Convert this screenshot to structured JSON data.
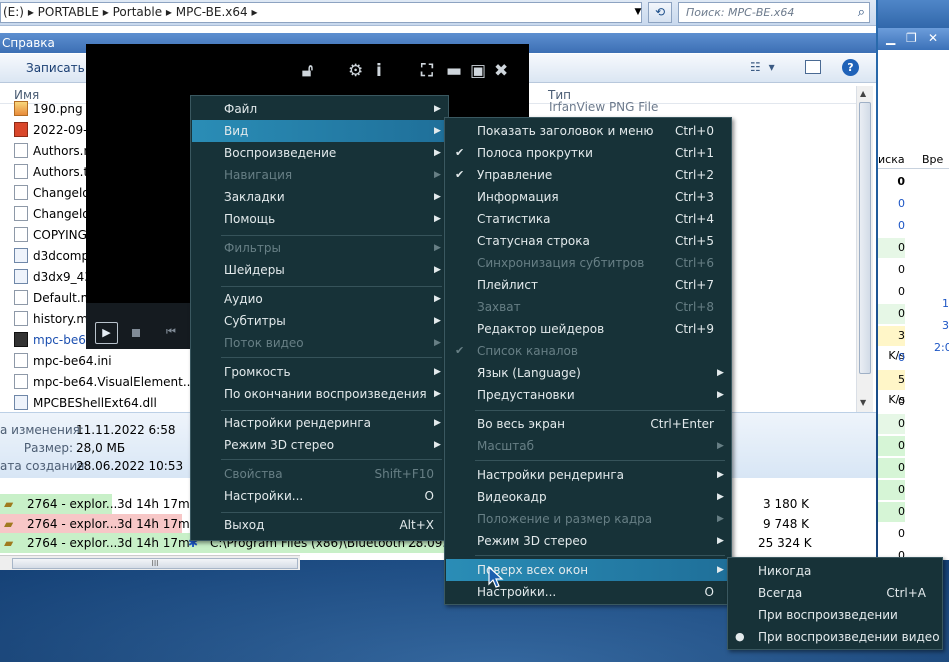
{
  "explorer": {
    "address_parts": [
      "(E:)",
      "PORTABLE",
      "Portable",
      "MPC-BE.x64"
    ],
    "search_placeholder": "Поиск: MPC-BE.x64",
    "menubar_label": "Справка",
    "toolbar_burn": "Записать н",
    "col_name": "Имя",
    "col_type": "Тип",
    "first_type": "IrfanView PNG File",
    "files": [
      {
        "name": "190.png",
        "icon": "image-icon"
      },
      {
        "name": "2022-09-1",
        "icon": "jpg-icon"
      },
      {
        "name": "Authors.n",
        "icon": "document-icon"
      },
      {
        "name": "Authors.tx",
        "icon": "document-icon"
      },
      {
        "name": "Changelo",
        "icon": "document-icon"
      },
      {
        "name": "Changelo",
        "icon": "document-icon"
      },
      {
        "name": "COPYING",
        "icon": "document-icon"
      },
      {
        "name": "d3dcomp",
        "icon": "dll-icon"
      },
      {
        "name": "d3dx9_43.",
        "icon": "dll-icon"
      },
      {
        "name": "Default.m",
        "icon": "document-icon"
      },
      {
        "name": "history.m",
        "icon": "document-icon"
      },
      {
        "name": "mpc-be64",
        "icon": "exe-icon"
      },
      {
        "name": "mpc-be64.ini",
        "icon": "document-icon"
      },
      {
        "name": "mpc-be64.VisualElement...",
        "icon": "document-icon"
      },
      {
        "name": "MPCBEShellExt64.dll",
        "icon": "dll-icon"
      }
    ],
    "details": [
      {
        "label": "а изменения:",
        "value": "11.11.2022 6:58"
      },
      {
        "label": "Размер:",
        "value": "28,0 МБ"
      },
      {
        "label": "ата создания:",
        "value": "28.06.2022 10:53"
      }
    ]
  },
  "processes": {
    "rows": [
      {
        "name": "2764 - explor...",
        "time": "3d 14h 17m",
        "path": "",
        "date": "",
        "mem": "3 180 K"
      },
      {
        "name": "2764 - explor...",
        "time": "3d 14h 17m",
        "path": "",
        "date": "",
        "mem": "9 748 K"
      },
      {
        "name": "2764 - explor...",
        "time": "3d 14h 17m",
        "path": "C:\\Program Files (x86)\\Bluetooth ...",
        "date": "28.09.2",
        "mem": "25 324 K"
      }
    ],
    "right_header": [
      "иска",
      "Вре"
    ],
    "right_values": [
      "0",
      "0",
      "0",
      "0",
      "0",
      "0",
      "0",
      "3 K/s",
      "0",
      "5 K/s",
      "0",
      "0",
      "0",
      "0",
      "0",
      "0",
      "0",
      "0",
      "0",
      "0"
    ],
    "right_extra": [
      "1",
      "3",
      "2:0"
    ],
    "hscroll_grip": "III"
  },
  "player": {
    "icons": [
      "unlock-icon",
      "gear-icon",
      "info-icon",
      "fullscreen-icon",
      "minimize-icon",
      "maximize-icon",
      "close-icon"
    ]
  },
  "menu_main": {
    "items": [
      {
        "label": "Файл",
        "sub": true
      },
      {
        "label": "Вид",
        "sub": true,
        "highlight": true
      },
      {
        "label": "Воспроизведение",
        "sub": true
      },
      {
        "label": "Навигация",
        "sub": true,
        "disabled": true
      },
      {
        "label": "Закладки",
        "sub": true
      },
      {
        "label": "Помощь",
        "sub": true
      },
      {
        "label": "Фильтры",
        "sub": true,
        "disabled": true
      },
      {
        "label": "Шейдеры",
        "sub": true
      },
      {
        "label": "Аудио",
        "sub": true
      },
      {
        "label": "Субтитры",
        "sub": true
      },
      {
        "label": "Поток видео",
        "sub": true,
        "disabled": true
      },
      {
        "label": "Громкость",
        "sub": true
      },
      {
        "label": "По окончании воспроизведения",
        "sub": true
      },
      {
        "label": "Настройки рендеринга",
        "sub": true
      },
      {
        "label": "Режим 3D стерео",
        "sub": true
      },
      {
        "label": "Свойства",
        "shortcut": "Shift+F10",
        "disabled": true
      },
      {
        "label": "Настройки...",
        "shortcut": "O"
      },
      {
        "label": "Выход",
        "shortcut": "Alt+X"
      }
    ]
  },
  "menu_view": {
    "items": [
      {
        "label": "Показать заголовок и меню",
        "shortcut": "Ctrl+0"
      },
      {
        "label": "Полоса прокрутки",
        "shortcut": "Ctrl+1",
        "checked": true
      },
      {
        "label": "Управление",
        "shortcut": "Ctrl+2",
        "checked": true
      },
      {
        "label": "Информация",
        "shortcut": "Ctrl+3"
      },
      {
        "label": "Статистика",
        "shortcut": "Ctrl+4"
      },
      {
        "label": "Статусная строка",
        "shortcut": "Ctrl+5"
      },
      {
        "label": "Синхронизация субтитров",
        "shortcut": "Ctrl+6",
        "disabled": true
      },
      {
        "label": "Плейлист",
        "shortcut": "Ctrl+7"
      },
      {
        "label": "Захват",
        "shortcut": "Ctrl+8",
        "disabled": true
      },
      {
        "label": "Редактор шейдеров",
        "shortcut": "Ctrl+9"
      },
      {
        "label": "Список каналов",
        "checked": true,
        "disabled": true
      },
      {
        "label": "Язык (Language)",
        "sub": true
      },
      {
        "label": "Предустановки",
        "sub": true
      },
      {
        "label": "Во весь экран",
        "shortcut": "Ctrl+Enter"
      },
      {
        "label": "Масштаб",
        "sub": true,
        "disabled": true
      },
      {
        "label": "Настройки рендеринга",
        "sub": true
      },
      {
        "label": "Видеокадр",
        "sub": true
      },
      {
        "label": "Положение и размер кадра",
        "sub": true,
        "disabled": true
      },
      {
        "label": "Режим 3D стерео",
        "sub": true
      },
      {
        "label": "Поверх всех окон",
        "sub": true,
        "highlight": true
      },
      {
        "label": "Настройки...",
        "shortcut": "O"
      }
    ]
  },
  "menu_ontop": {
    "items": [
      {
        "label": "Никогда"
      },
      {
        "label": "Всегда",
        "shortcut": "Ctrl+A"
      },
      {
        "label": "При воспроизведении"
      },
      {
        "label": "При воспроизведении видео",
        "radio": true
      }
    ]
  },
  "colors": {
    "menu_bg": "#173238",
    "menu_highlight": "#2a8db6",
    "menu_disabled": "#677f85",
    "proc_pink": "#f7c7c7",
    "proc_green": "#c8f0c8"
  }
}
